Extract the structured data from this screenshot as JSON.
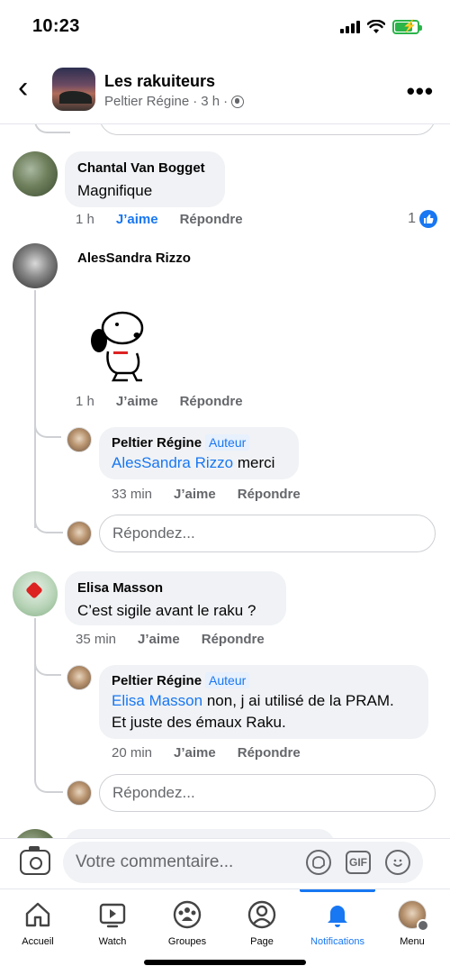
{
  "status_bar": {
    "time": "10:23"
  },
  "header": {
    "group_name": "Les rakuiteurs",
    "author": "Peltier Régine",
    "time": "3 h",
    "separator": "·"
  },
  "comments": [
    {
      "author": "Chantal Van Bogget",
      "text": "Magnifique",
      "time": "1 h",
      "like_label": "J’aime",
      "reply_label": "Répondre",
      "reaction_count": "1"
    },
    {
      "author": "AlesSandra Rizzo",
      "sticker": "snoopy-sticker",
      "time": "1 h",
      "like_label": "J’aime",
      "reply_label": "Répondre",
      "replies": [
        {
          "author": "Peltier Régine",
          "badge": "Auteur",
          "mention": "AlesSandra Rizzo",
          "text": " merci",
          "time": "33 min",
          "like_label": "J’aime",
          "reply_label": "Répondre"
        }
      ],
      "reply_placeholder": "Répondez..."
    },
    {
      "author": "Elisa Masson",
      "text": "C’est sigile  avant le raku ?",
      "time": "35 min",
      "like_label": "J’aime",
      "reply_label": "Répondre",
      "replies": [
        {
          "author": "Peltier Régine",
          "badge": "Auteur",
          "mention": "Elisa Masson",
          "text": " non,  j ai utilisé de la PRAM.",
          "text2": "Et juste des émaux Raku.",
          "time": "20 min",
          "like_label": "J’aime",
          "reply_label": "Répondre"
        }
      ],
      "reply_placeholder": "Répondez..."
    }
  ],
  "composer": {
    "placeholder": "Votre commentaire...",
    "gif_label": "GIF"
  },
  "tabbar": {
    "items": [
      {
        "label": "Accueil",
        "icon": "home-icon"
      },
      {
        "label": "Watch",
        "icon": "watch-icon"
      },
      {
        "label": "Groupes",
        "icon": "groups-icon"
      },
      {
        "label": "Page",
        "icon": "page-icon"
      },
      {
        "label": "Notifications",
        "icon": "bell-icon",
        "active": true
      },
      {
        "label": "Menu",
        "icon": "menu-avatar-icon"
      }
    ]
  },
  "colors": {
    "accent": "#1877f2",
    "bubble": "#f0f2f5",
    "muted": "#65676b"
  }
}
